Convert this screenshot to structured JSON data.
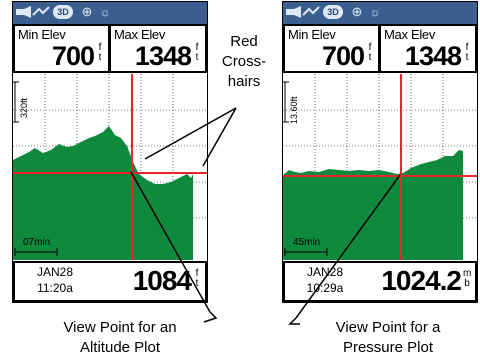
{
  "left_screen": {
    "field_left": {
      "label": "Min Elev",
      "value": "700",
      "unit": "f t"
    },
    "field_right": {
      "label": "Max Elev",
      "value": "1348",
      "unit": "f t"
    },
    "scale_label": "320ft",
    "time_scale": "07min",
    "date": "JAN28",
    "time": "11:20a",
    "current_value": "1084",
    "current_unit": "f t"
  },
  "right_screen": {
    "field_left": {
      "label": "Min Elev",
      "value": "700",
      "unit": "f t"
    },
    "field_right": {
      "label": "Max Elev",
      "value": "1348",
      "unit": "f t"
    },
    "scale_label": "13.60ft",
    "time_scale": "45min",
    "date": "JAN28",
    "time": "10:29a",
    "current_value": "1024.2",
    "current_unit": "m b"
  },
  "annotations": {
    "crosshairs": "Red\nCross-\nhairs",
    "altitude": "View Point for an\nAltitude Plot",
    "pressure": "View Point for a\nPressure Plot"
  },
  "colors": {
    "plot_fill": "#0f8a3d",
    "crosshair": "#e8262b",
    "statusbar": "#3a5f8f"
  },
  "icons": [
    "signal-icon",
    "3d-icon",
    "satellite-icon",
    "backlight-icon"
  ]
}
